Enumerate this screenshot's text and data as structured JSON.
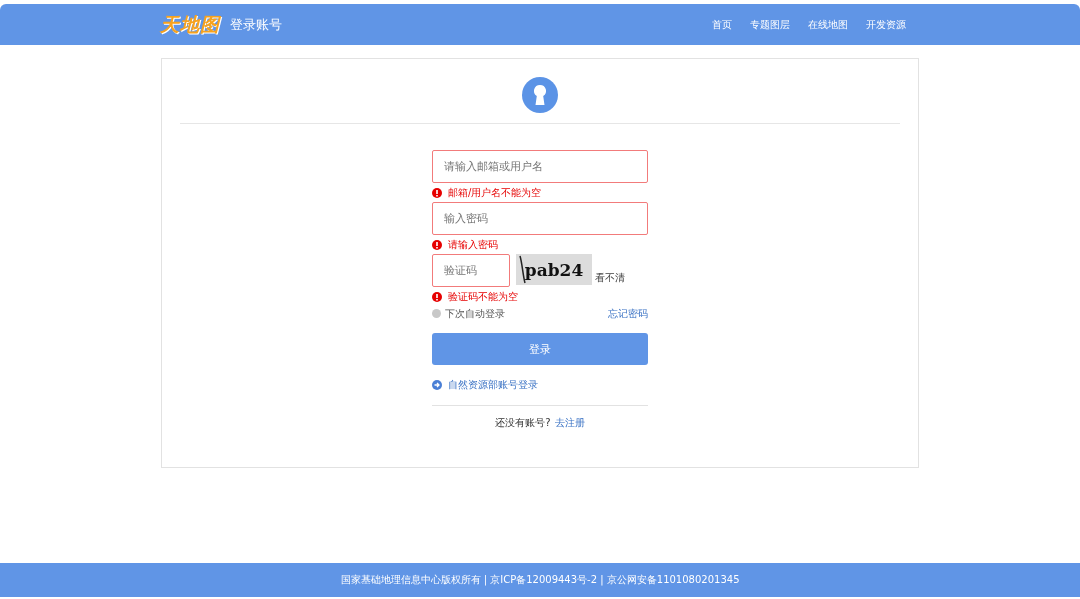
{
  "header": {
    "logo": "天地图",
    "title": "登录账号",
    "nav": [
      {
        "label": "首页"
      },
      {
        "label": "专题图层"
      },
      {
        "label": "在线地图"
      },
      {
        "label": "开发资源"
      }
    ]
  },
  "form": {
    "fields": [
      {
        "kind": "text",
        "placeholder": "请输入邮箱或用户名",
        "invalid": true,
        "error": "邮箱/用户名不能为空"
      },
      {
        "kind": "password",
        "placeholder": "输入密码",
        "invalid": true,
        "error": "请输入密码"
      },
      {
        "kind": "captcha",
        "placeholder": "验证码",
        "invalid": true,
        "error": "验证码不能为空",
        "captcha": "pab24",
        "refresh": "看不清"
      }
    ],
    "remember": {
      "label": "下次自动登录",
      "checked": false
    },
    "forgot": "忘记密码",
    "submit": "登录",
    "alt_login": "自然资源部账号登录",
    "register_prompt": "还没有账号?",
    "register_link": "去注册"
  },
  "footer": "国家基础地理信息中心版权所有 | 京ICP备12009443号-2 | 京公网安备1101080201345"
}
